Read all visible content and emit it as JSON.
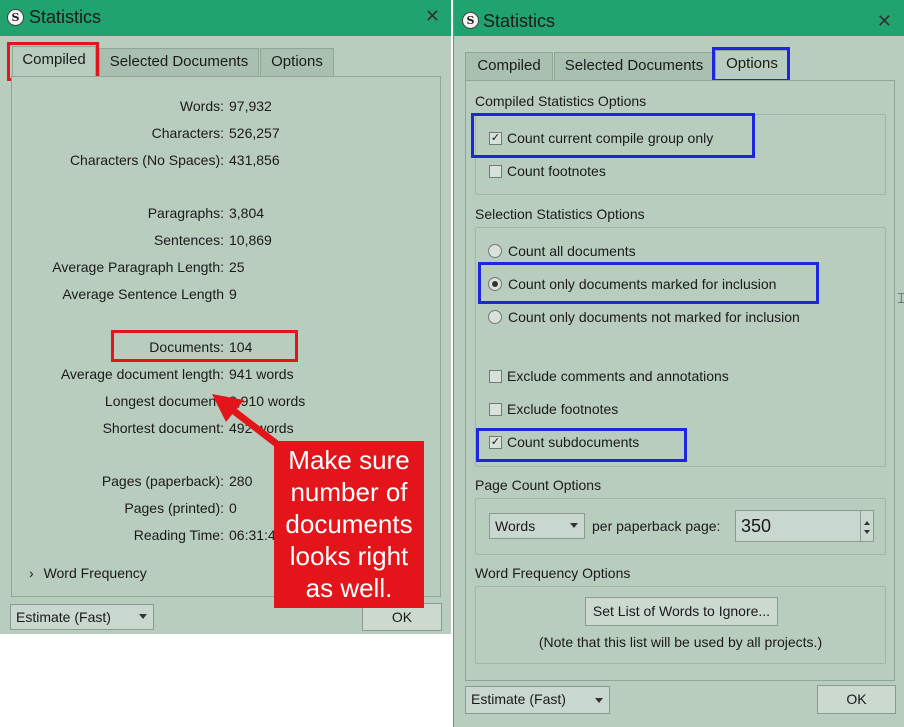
{
  "left_window": {
    "title": "Statistics",
    "close": "✕",
    "tabs": [
      "Compiled",
      "Selected Documents",
      "Options"
    ],
    "stats": [
      {
        "label": "Words:",
        "value": "97,932"
      },
      {
        "label": "Characters:",
        "value": "526,257"
      },
      {
        "label": "Characters (No Spaces):",
        "value": "431,856"
      },
      {
        "label": "Paragraphs:",
        "value": "3,804"
      },
      {
        "label": "Sentences:",
        "value": "10,869"
      },
      {
        "label": "Average Paragraph Length:",
        "value": "25"
      },
      {
        "label": "Average Sentence Length",
        "value": "9"
      },
      {
        "label": "Documents:",
        "value": "104"
      },
      {
        "label": "Average document length:",
        "value": "941 words"
      },
      {
        "label": "Longest document:",
        "value": "2,910 words"
      },
      {
        "label": "Shortest document:",
        "value": "492 words"
      },
      {
        "label": "Pages (paperback):",
        "value": "280"
      },
      {
        "label": "Pages (printed):",
        "value": "0"
      },
      {
        "label": "Reading Time:",
        "value": "06:31:45"
      }
    ],
    "word_frequency": "Word Frequency",
    "estimate": "Estimate (Fast)",
    "ok": "OK"
  },
  "callout": {
    "text_lines": [
      "Make sure",
      "number of",
      "documents",
      "looks right",
      "as well."
    ],
    "color": "#e3151b"
  },
  "right_window": {
    "title": "Statistics",
    "close": "✕",
    "tabs": [
      "Compiled",
      "Selected Documents",
      "Options"
    ],
    "compiled_section": "Compiled Statistics Options",
    "count_compile_group": "Count current compile group only",
    "count_footnotes": "Count footnotes",
    "selection_section": "Selection Statistics Options",
    "count_all": "Count all documents",
    "count_marked": "Count only documents marked for inclusion",
    "count_not_marked": "Count only documents not marked for inclusion",
    "exclude_comments": "Exclude comments and annotations",
    "exclude_footnotes": "Exclude footnotes",
    "count_subdocs": "Count subdocuments",
    "page_count_section": "Page Count Options",
    "page_unit": "Words",
    "per_page_label": "per paperback page:",
    "per_page_value": "350",
    "word_freq_section": "Word Frequency Options",
    "ignore_button": "Set List of Words to Ignore...",
    "ignore_note": "(Note that this list will be used by all projects.)",
    "estimate": "Estimate (Fast)",
    "ok": "OK"
  },
  "colors": {
    "titlebar": "#21a36f",
    "window_bg": "#b9cdbf",
    "highlight_red": "#e3151b",
    "highlight_blue": "#1c25e0"
  }
}
